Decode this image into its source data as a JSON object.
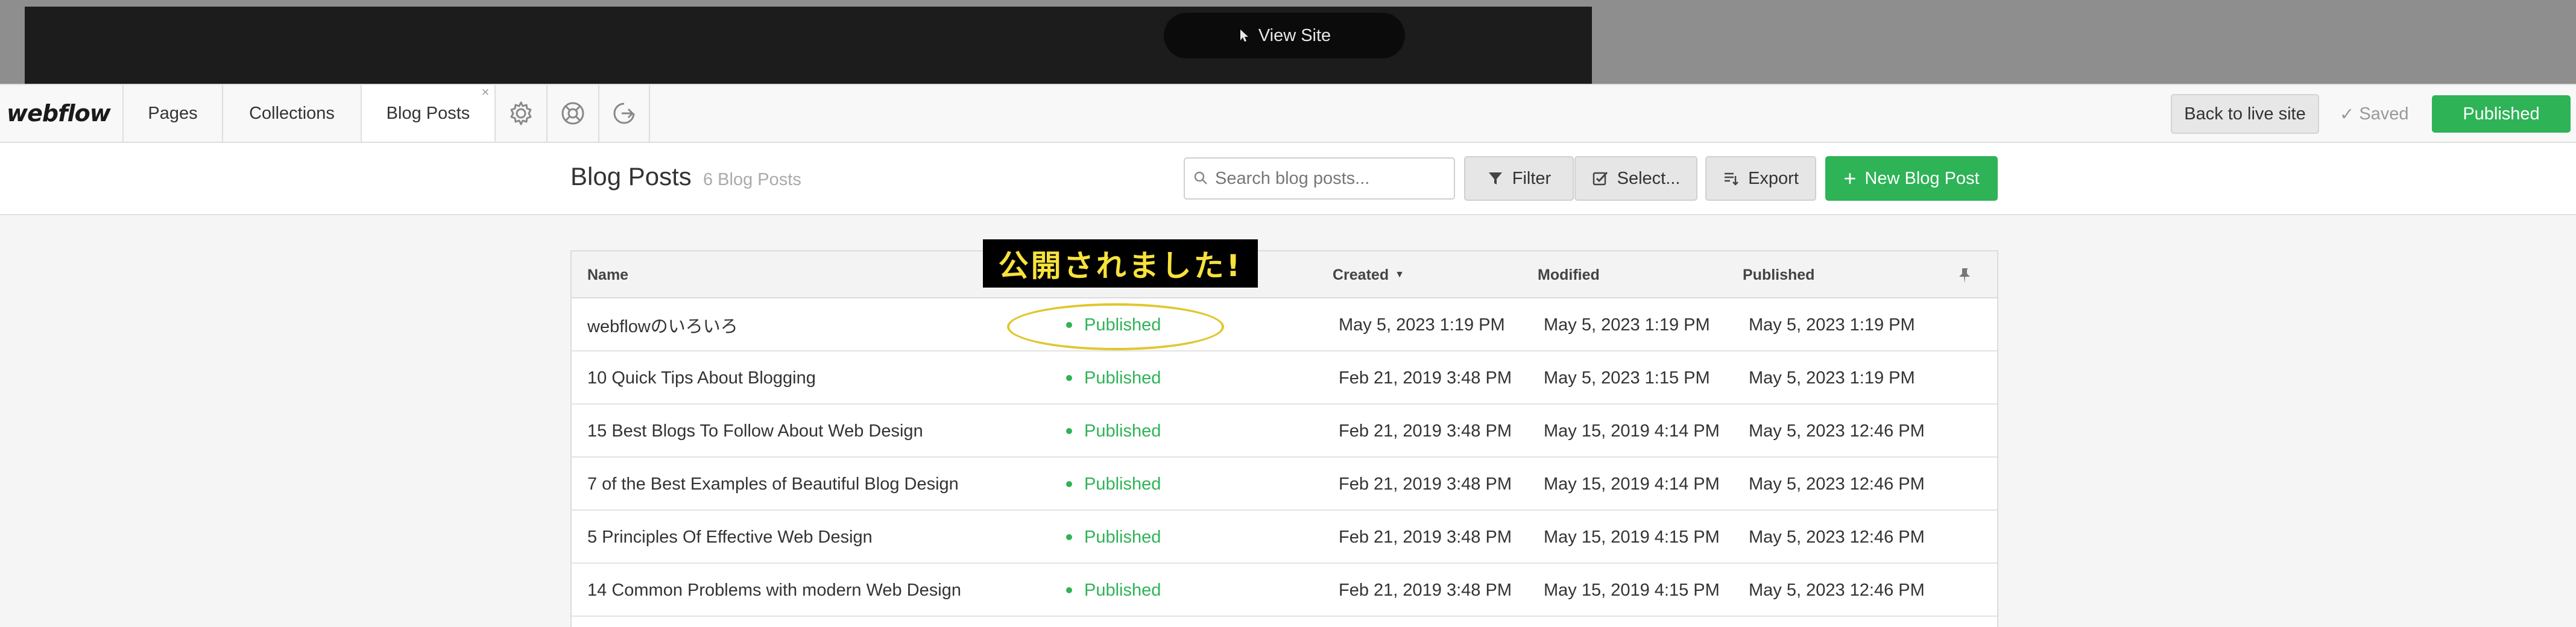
{
  "preview": {
    "view_site_label": "View Site"
  },
  "editor": {
    "logo": "webflow",
    "tabs": [
      {
        "label": "Pages"
      },
      {
        "label": "Collections"
      },
      {
        "label": "Blog Posts",
        "active": true,
        "close": "×"
      }
    ],
    "icons": [
      "gear-icon",
      "help-icon",
      "share-icon"
    ],
    "back_label": "Back to live site",
    "saved_check": "✓",
    "saved_label": "Saved",
    "published_label": "Published"
  },
  "header": {
    "title": "Blog Posts",
    "count": "6 Blog Posts",
    "search_placeholder": "Search blog posts...",
    "filter_label": "Filter",
    "select_label": "Select...",
    "export_label": "Export",
    "new_label": "New Blog Post"
  },
  "table": {
    "columns": {
      "name": "Name",
      "created": "Created",
      "modified": "Modified",
      "published": "Published"
    },
    "rows": [
      {
        "name": "webflowのいろいろ",
        "status": "Published",
        "created": "May 5, 2023 1:19 PM",
        "modified": "May 5, 2023 1:19 PM",
        "published": "May 5, 2023 1:19 PM"
      },
      {
        "name": "10 Quick Tips About Blogging",
        "status": "Published",
        "created": "Feb 21, 2019 3:48 PM",
        "modified": "May 5, 2023 1:15 PM",
        "published": "May 5, 2023 1:19 PM"
      },
      {
        "name": "15 Best Blogs To Follow About Web Design",
        "status": "Published",
        "created": "Feb 21, 2019 3:48 PM",
        "modified": "May 15, 2019 4:14 PM",
        "published": "May 5, 2023 12:46 PM"
      },
      {
        "name": "7 of the Best Examples of Beautiful Blog Design",
        "status": "Published",
        "created": "Feb 21, 2019 3:48 PM",
        "modified": "May 15, 2019 4:14 PM",
        "published": "May 5, 2023 12:46 PM"
      },
      {
        "name": "5 Principles Of Effective Web Design",
        "status": "Published",
        "created": "Feb 21, 2019 3:48 PM",
        "modified": "May 15, 2019 4:15 PM",
        "published": "May 5, 2023 12:46 PM"
      },
      {
        "name": "14 Common Problems with modern Web Design",
        "status": "Published",
        "created": "Feb 21, 2019 3:48 PM",
        "modified": "May 15, 2019 4:15 PM",
        "published": "May 5, 2023 12:46 PM"
      }
    ]
  },
  "annotation": {
    "label": "公開されました!"
  },
  "colors": {
    "accent_green": "#2eb356",
    "annotation_yellow": "#e0c72e"
  }
}
